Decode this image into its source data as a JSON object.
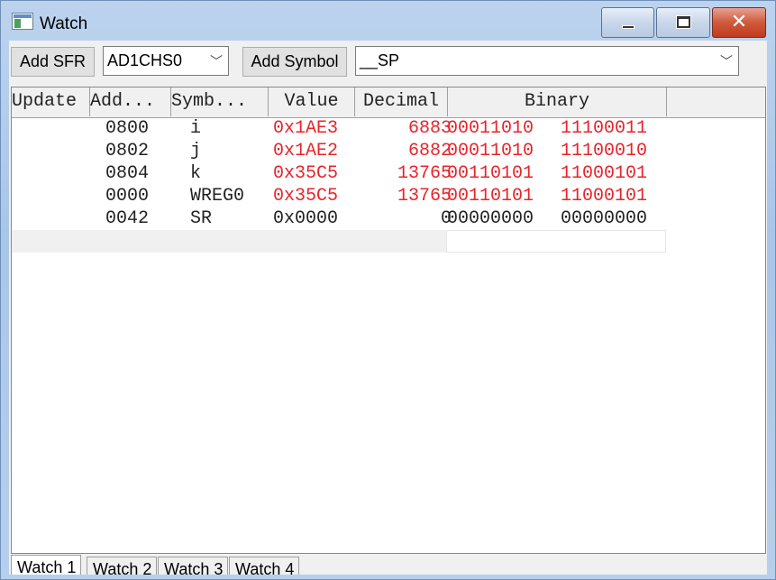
{
  "window": {
    "title": "Watch"
  },
  "toolbar": {
    "add_sfr_label": "Add SFR",
    "sfr_combo_value": "AD1CHS0",
    "add_symbol_label": "Add Symbol",
    "symbol_combo_value": "__SP"
  },
  "columns": [
    "Update",
    "Add...",
    "Symb...",
    "Value",
    "Decimal",
    "Binary"
  ],
  "rows": [
    {
      "address": "0800",
      "symbol": "i",
      "value": "0x1AE3",
      "decimal": "6883",
      "binary_hi": "00011010",
      "binary_lo": "11100011",
      "changed": true
    },
    {
      "address": "0802",
      "symbol": "j",
      "value": "0x1AE2",
      "decimal": "6882",
      "binary_hi": "00011010",
      "binary_lo": "11100010",
      "changed": true
    },
    {
      "address": "0804",
      "symbol": "k",
      "value": "0x35C5",
      "decimal": "13765",
      "binary_hi": "00110101",
      "binary_lo": "11000101",
      "changed": true
    },
    {
      "address": "0000",
      "symbol": "WREG0",
      "value": "0x35C5",
      "decimal": "13765",
      "binary_hi": "00110101",
      "binary_lo": "11000101",
      "changed": true
    },
    {
      "address": "0042",
      "symbol": "SR",
      "value": "0x0000",
      "decimal": "0",
      "binary_hi": "00000000",
      "binary_lo": "00000000",
      "changed": false
    }
  ],
  "tabs": [
    "Watch 1",
    "Watch 2",
    "Watch 3",
    "Watch 4"
  ],
  "active_tab": "Watch 1",
  "colors": {
    "changed_value": "#e8242b",
    "unchanged_value": "#222222",
    "close_button": "#c8432a"
  },
  "icons": {
    "app": "watch-window-icon",
    "minimize": "minimize-icon",
    "maximize": "maximize-icon",
    "close": "close-icon",
    "dropdown": "chevron-down-icon"
  }
}
